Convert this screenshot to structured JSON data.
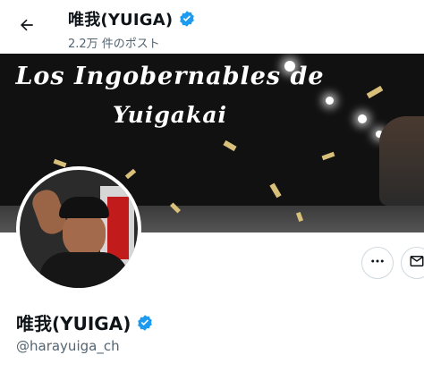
{
  "header": {
    "name": "唯我(YUIGA)",
    "post_count": "2.2万 件のポスト",
    "back_icon": "arrow-left-icon"
  },
  "banner": {
    "title_line1": "Los Ingobernables de",
    "title_line2": "Yuigakai"
  },
  "profile": {
    "display_name": "唯我(YUIGA)",
    "handle": "@harayuiga_ch",
    "verified": true
  },
  "actions": {
    "more_icon": "more-horizontal-icon",
    "dm_icon": "envelope-icon"
  },
  "colors": {
    "verified_blue": "#1d9bf0",
    "secondary_text": "#536471"
  }
}
